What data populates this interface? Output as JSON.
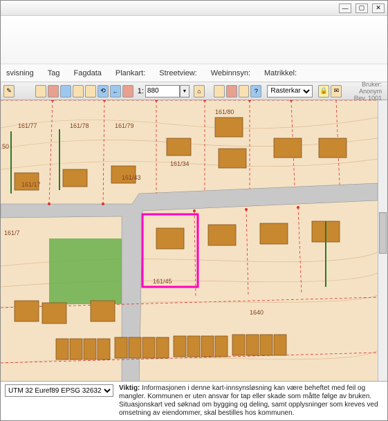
{
  "titlebar": {
    "min": "—",
    "max": "▢",
    "close": "✕"
  },
  "tabs": {
    "visning": "svisning",
    "tag": "Tag",
    "fagdata": "Fagdata",
    "plankart": "Plankart:",
    "streetview": "Streetview:",
    "webinnsyn": "Webinnsyn:",
    "matrikkel": "Matrikkel:"
  },
  "toolbar": {
    "scale_prefix": "1:",
    "scale_value": "880",
    "rasterkar": "Rasterkar"
  },
  "user": {
    "line1": "Bruker: Anonym",
    "line2": "Rev. 1001"
  },
  "footer": {
    "crs": "UTM 32 Euref89 EPSG 32632",
    "viktig_label": "Viktig:",
    "viktig_text": "Informasjonen i denne kart-innsynsløsning kan være beheftet med feil og mangler. Kommunen er uten ansvar for tap eller skade som måtte følge av bruken. Situasjonskart ved søknad om bygging og deling, samt opplysninger som kreves ved omsetning av eiendommer, skal bestilles hos kommunen."
  },
  "parcels": {
    "p161_77": "161/77",
    "p161_78": "161/78",
    "p161_79": "161/79",
    "p161_80": "161/80",
    "p161_17": "161/17",
    "p161_34": "161/34",
    "p161_43": "161/43",
    "p161_45": "161/45",
    "p161_7": "161/7",
    "p1640": "1640",
    "ext": "50"
  }
}
